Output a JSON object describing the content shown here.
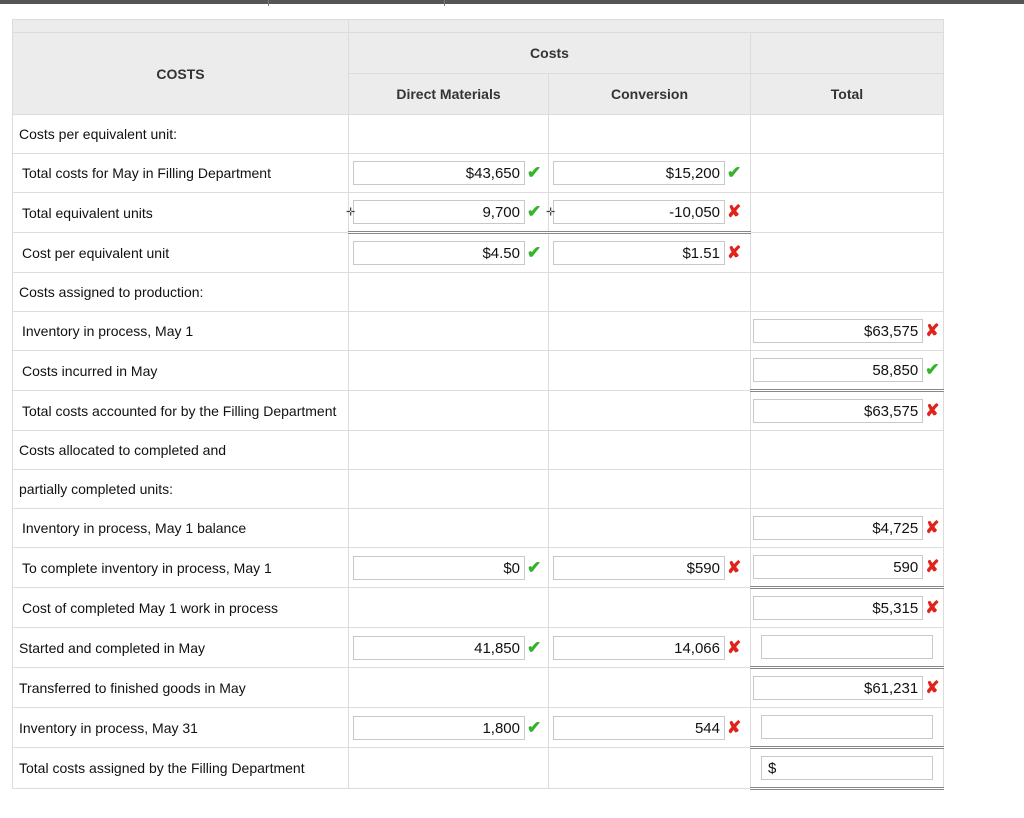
{
  "header": {
    "costs_label": "COSTS",
    "group_label": "Costs",
    "col_dm": "Direct Materials",
    "col_conv": "Conversion",
    "col_total": "Total"
  },
  "rows": [
    {
      "label": "Costs per equivalent unit:"
    },
    {
      "label": "Total costs for May in Filling Department",
      "dm": "$43,650",
      "dm_status": "correct",
      "cv": "$15,200",
      "cv_status": "correct"
    },
    {
      "label": "Total equivalent units",
      "dm": "9,700",
      "dm_status": "correct",
      "cv": "-10,050",
      "cv_status": "incorrect"
    },
    {
      "label": "Cost per equivalent unit",
      "dm": "$4.50",
      "dm_status": "correct",
      "cv": "$1.51",
      "cv_status": "incorrect"
    },
    {
      "label": "Costs assigned to production:"
    },
    {
      "label": "Inventory in process, May 1",
      "total": "$63,575",
      "total_status": "incorrect"
    },
    {
      "label": "Costs incurred in May",
      "total": "58,850",
      "total_status": "correct"
    },
    {
      "label": "Total costs accounted for by the Filling Department",
      "total": "$63,575",
      "total_status": "incorrect"
    },
    {
      "label": "Costs allocated to completed and"
    },
    {
      "label": "partially completed units:"
    },
    {
      "label": "Inventory in process, May 1 balance",
      "total": "$4,725",
      "total_status": "incorrect"
    },
    {
      "label": "To complete inventory in process, May 1",
      "dm": "$0",
      "dm_status": "correct",
      "cv": "$590",
      "cv_status": "incorrect",
      "total": "590",
      "total_status": "incorrect"
    },
    {
      "label": "Cost of completed May 1 work in process",
      "total": "$5,315",
      "total_status": "incorrect"
    },
    {
      "label": "Started and completed in May",
      "dm": "41,850",
      "dm_status": "correct",
      "cv": "14,066",
      "cv_status": "incorrect",
      "total": ""
    },
    {
      "label": "Transferred to finished goods in May",
      "total": "$61,231",
      "total_status": "incorrect"
    },
    {
      "label": "Inventory in process, May 31",
      "dm": "1,800",
      "dm_status": "correct",
      "cv": "544",
      "cv_status": "incorrect",
      "total": ""
    },
    {
      "label": "Total costs assigned by the Filling Department",
      "total_prefix": "$",
      "total": ""
    }
  ],
  "icons": {
    "correct": "check-mark-icon",
    "incorrect": "x-mark-icon"
  },
  "colors": {
    "correct": "#35b32a",
    "incorrect": "#e0241b",
    "header_bg": "#ececec"
  }
}
